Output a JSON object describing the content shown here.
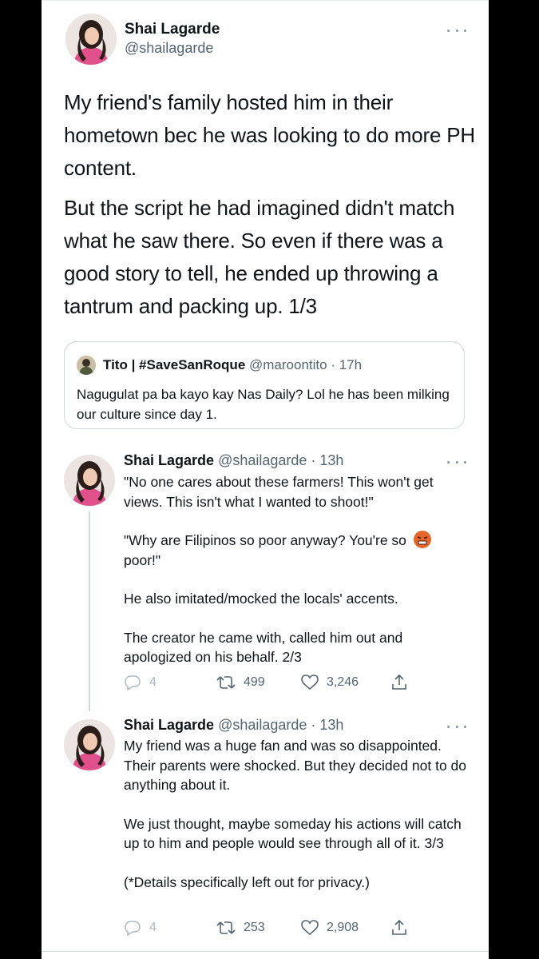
{
  "main_tweet": {
    "author_name": "Shai Lagarde",
    "author_handle": "@shailagarde",
    "paragraphs": [
      "My friend's family hosted him in their hometown bec he was looking to do more PH content.",
      "But the script he had imagined didn't match what he saw there. So even if there was a good story to tell, he ended up throwing a tantrum and packing up. 1/3"
    ],
    "icons": {
      "avatar": "profile-photo",
      "more": "more-horizontal-icon"
    }
  },
  "quote": {
    "author_name": "Tito | #SaveSanRoque",
    "author_handle": "@maroontito",
    "time": "· 17h",
    "text": "Nagugulat pa ba kayo kay Nas Daily? Lol he has been milking our culture since day 1."
  },
  "replies": [
    {
      "author_name": "Shai Lagarde",
      "author_meta": "@shailagarde · 13h",
      "paragraphs": [
        "\"No one cares about these farmers! This won't get views. This isn't what I wanted to shoot!\"",
        "\"Why are Filipinos so poor anyway? You're so",
        "poor!\"",
        "He also imitated/mocked the locals' accents.",
        "The creator he came with, called him out and apologized on his behalf. 2/3"
      ],
      "emoji": "angry-face-emoji",
      "stats": {
        "replies": "4",
        "retweets": "499",
        "likes": "3,246"
      }
    },
    {
      "author_name": "Shai Lagarde",
      "author_meta": "@shailagarde · 13h",
      "paragraphs": [
        "My friend was a huge fan and was so disappointed. Their parents were shocked. But they decided not to do anything about it.",
        "We just thought, maybe someday his actions will catch up to him and people would see through all of it. 3/3",
        "(*Details specifically left out for privacy.)"
      ],
      "stats": {
        "replies": "4",
        "retweets": "253",
        "likes": "2,908"
      }
    }
  ],
  "colors": {
    "text": "#0f1419",
    "secondary": "#536471",
    "border": "#cfd9de",
    "background": "#000000",
    "card": "#ffffff"
  }
}
